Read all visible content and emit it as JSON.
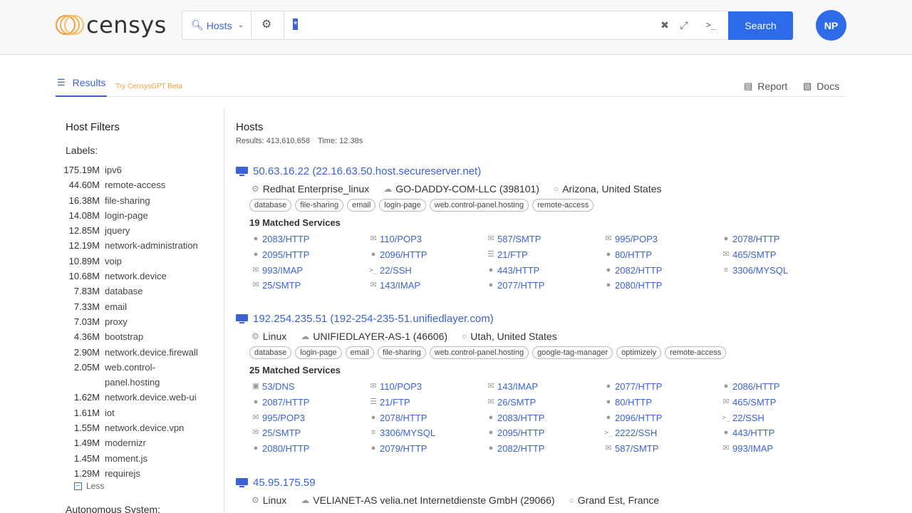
{
  "header": {
    "logo_text": "censys",
    "search_type": "Hosts",
    "query": "*",
    "search_button": "Search",
    "avatar_initials": "NP",
    "colors": {
      "accent": "#2d6bea",
      "link": "#3b63d6",
      "logo": "#f29a37"
    }
  },
  "subnav": {
    "results_tab": "Results",
    "try_gpt": "Try CensysGPT Beta",
    "report": "Report",
    "docs": "Docs"
  },
  "sidebar": {
    "title": "Host Filters",
    "labels_heading": "Labels:",
    "labels": [
      {
        "count": "175.19M",
        "name": "ipv6"
      },
      {
        "count": "44.60M",
        "name": "remote-access"
      },
      {
        "count": "16.38M",
        "name": "file-sharing"
      },
      {
        "count": "14.08M",
        "name": "login-page"
      },
      {
        "count": "12.85M",
        "name": "jquery"
      },
      {
        "count": "12.19M",
        "name": "network-administration"
      },
      {
        "count": "10.89M",
        "name": "voip"
      },
      {
        "count": "10.68M",
        "name": "network.device"
      },
      {
        "count": "7.83M",
        "name": "database"
      },
      {
        "count": "7.33M",
        "name": "email"
      },
      {
        "count": "7.03M",
        "name": "proxy"
      },
      {
        "count": "4.36M",
        "name": "bootstrap"
      },
      {
        "count": "2.90M",
        "name": "network.device.firewall"
      },
      {
        "count": "2.05M",
        "name": "web.control-"
      },
      {
        "count": "",
        "name": "panel.hosting"
      },
      {
        "count": "1.62M",
        "name": "network.device.web-ui"
      },
      {
        "count": "1.61M",
        "name": "iot"
      },
      {
        "count": "1.55M",
        "name": "network.device.vpn"
      },
      {
        "count": "1.49M",
        "name": "modernizr"
      },
      {
        "count": "1.45M",
        "name": "moment.js"
      },
      {
        "count": "1.29M",
        "name": "requirejs"
      }
    ],
    "less": "Less",
    "next_heading": "Autonomous System:"
  },
  "main": {
    "title": "Hosts",
    "results_label": "Results: 413,610,658",
    "time_label": "Time: 12.38s",
    "hosts": [
      {
        "title": "50.63.16.22 (22.16.63.50.host.secureserver.net)",
        "os": "Redhat Enterprise_linux",
        "asn": "GO-DADDY-COM-LLC (398101)",
        "location": "Arizona, United States",
        "tags": [
          "database",
          "file-sharing",
          "email",
          "login-page",
          "web.control-panel.hosting",
          "remote-access"
        ],
        "matched": "19 Matched Services",
        "services": [
          {
            "icon": "globe",
            "label": "2083/HTTP"
          },
          {
            "icon": "mail",
            "label": "110/POP3"
          },
          {
            "icon": "mail",
            "label": "587/SMTP"
          },
          {
            "icon": "mail",
            "label": "995/POP3"
          },
          {
            "icon": "globe",
            "label": "2078/HTTP"
          },
          {
            "icon": "globe",
            "label": "2095/HTTP"
          },
          {
            "icon": "globe",
            "label": "2096/HTTP"
          },
          {
            "icon": "file",
            "label": "21/FTP"
          },
          {
            "icon": "globe",
            "label": "80/HTTP"
          },
          {
            "icon": "mail",
            "label": "465/SMTP"
          },
          {
            "icon": "mail",
            "label": "993/IMAP"
          },
          {
            "icon": "terminal",
            "label": "22/SSH"
          },
          {
            "icon": "globe",
            "label": "443/HTTP"
          },
          {
            "icon": "globe",
            "label": "2082/HTTP"
          },
          {
            "icon": "database",
            "label": "3306/MYSQL"
          },
          {
            "icon": "mail",
            "label": "25/SMTP"
          },
          {
            "icon": "mail",
            "label": "143/IMAP"
          },
          {
            "icon": "globe",
            "label": "2077/HTTP"
          },
          {
            "icon": "globe",
            "label": "2080/HTTP"
          }
        ]
      },
      {
        "title": "192.254.235.51 (192-254-235-51.unifiedlayer.com)",
        "os": "Linux",
        "asn": "UNIFIEDLAYER-AS-1 (46606)",
        "location": "Utah, United States",
        "tags": [
          "database",
          "login-page",
          "email",
          "file-sharing",
          "web.control-panel.hosting",
          "google-tag-manager",
          "optimizely",
          "remote-access"
        ],
        "matched": "25 Matched Services",
        "services": [
          {
            "icon": "dns",
            "label": "53/DNS"
          },
          {
            "icon": "mail",
            "label": "110/POP3"
          },
          {
            "icon": "mail",
            "label": "143/IMAP"
          },
          {
            "icon": "globe",
            "label": "2077/HTTP"
          },
          {
            "icon": "globe",
            "label": "2086/HTTP"
          },
          {
            "icon": "globe",
            "label": "2087/HTTP"
          },
          {
            "icon": "file",
            "label": "21/FTP"
          },
          {
            "icon": "mail",
            "label": "26/SMTP"
          },
          {
            "icon": "globe",
            "label": "80/HTTP"
          },
          {
            "icon": "mail",
            "label": "465/SMTP"
          },
          {
            "icon": "mail",
            "label": "995/POP3"
          },
          {
            "icon": "globe",
            "label": "2078/HTTP"
          },
          {
            "icon": "globe",
            "label": "2083/HTTP"
          },
          {
            "icon": "globe",
            "label": "2096/HTTP"
          },
          {
            "icon": "terminal",
            "label": "22/SSH"
          },
          {
            "icon": "mail",
            "label": "25/SMTP"
          },
          {
            "icon": "database",
            "label": "3306/MYSQL"
          },
          {
            "icon": "globe",
            "label": "2095/HTTP"
          },
          {
            "icon": "terminal",
            "label": "2222/SSH"
          },
          {
            "icon": "globe",
            "label": "443/HTTP"
          },
          {
            "icon": "globe",
            "label": "2080/HTTP"
          },
          {
            "icon": "globe",
            "label": "2079/HTTP"
          },
          {
            "icon": "globe",
            "label": "2082/HTTP"
          },
          {
            "icon": "mail",
            "label": "587/SMTP"
          },
          {
            "icon": "mail",
            "label": "993/IMAP"
          }
        ]
      },
      {
        "title": "45.95.175.59",
        "os": "Linux",
        "asn": "VELIANET-AS velia.net Internetdienste GmbH (29066)",
        "location": "Grand Est, France",
        "tags": [],
        "matched": "",
        "services": []
      }
    ]
  }
}
